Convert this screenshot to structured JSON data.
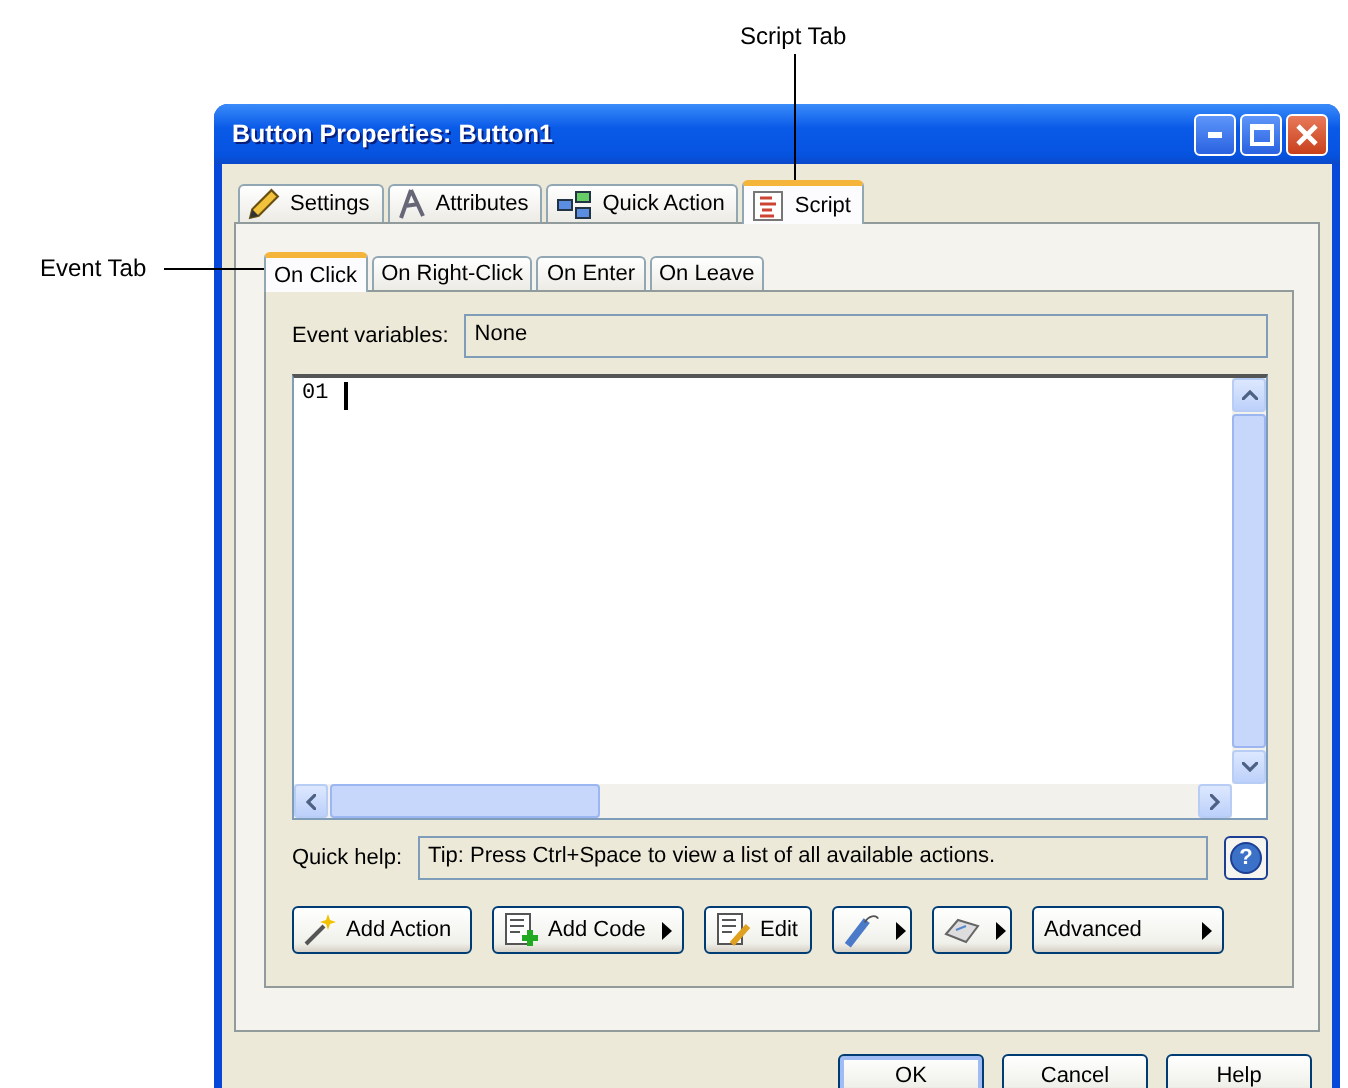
{
  "callouts": [
    {
      "text": "Script Tab",
      "kind": "down"
    },
    {
      "text": "Event Tab",
      "kind": "right"
    }
  ],
  "window": {
    "title": "Button Properties: Button1"
  },
  "tabs": [
    {
      "label": "Settings",
      "selected": false
    },
    {
      "label": "Attributes",
      "selected": false
    },
    {
      "label": "Quick Action",
      "selected": false
    },
    {
      "label": "Script",
      "selected": true
    }
  ],
  "event_tabs": [
    {
      "label": "On Click",
      "selected": true
    },
    {
      "label": "On Right-Click",
      "selected": false
    },
    {
      "label": "On Enter",
      "selected": false
    },
    {
      "label": "On Leave",
      "selected": false
    }
  ],
  "event_variables": {
    "label": "Event variables:",
    "value": "None"
  },
  "editor": {
    "line_number": "01"
  },
  "quick_help": {
    "label": "Quick help:",
    "value": "Tip: Press Ctrl+Space to view a list of all available actions.",
    "button": "?"
  },
  "toolbar": [
    {
      "label": "Add Action",
      "menu": false
    },
    {
      "label": "Add Code",
      "menu": true
    },
    {
      "label": "Edit",
      "menu": false
    },
    {
      "menu": true
    },
    {
      "menu": true
    },
    {
      "label": "Advanced",
      "menu": true
    }
  ],
  "buttons": [
    "OK",
    "Cancel",
    "Help"
  ]
}
